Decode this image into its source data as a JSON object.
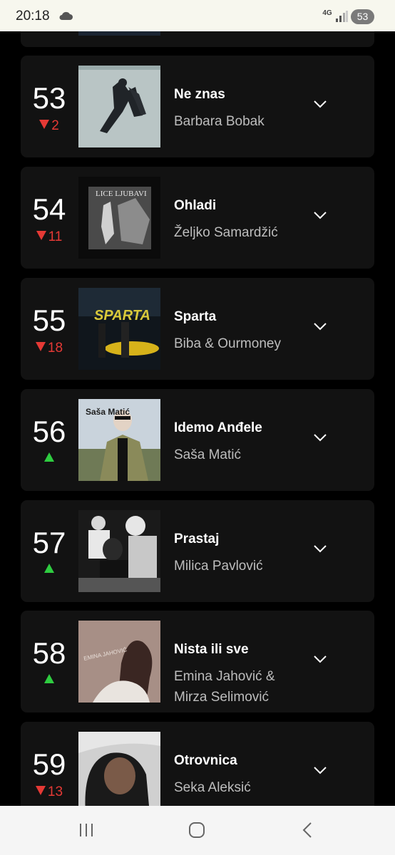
{
  "status_bar": {
    "time": "20:18",
    "network": "4G",
    "battery": "53"
  },
  "chart": [
    {
      "rank": "53",
      "change": "2",
      "direction": "down",
      "title": "Ne znas",
      "artist": "Barbara Bobak"
    },
    {
      "rank": "54",
      "change": "11",
      "direction": "down",
      "title": "Ohladi",
      "artist": "Željko Samardžić"
    },
    {
      "rank": "55",
      "change": "18",
      "direction": "down",
      "title": "Sparta",
      "artist": "Biba & Ourmoney"
    },
    {
      "rank": "56",
      "change": "",
      "direction": "up",
      "title": "Idemo Anđele",
      "artist": "Saša Matić"
    },
    {
      "rank": "57",
      "change": "",
      "direction": "up",
      "title": "Prastaj",
      "artist": "Milica Pavlović"
    },
    {
      "rank": "58",
      "change": "",
      "direction": "up",
      "title": "Nista ili sve",
      "artist": "Emina Jahović & Mirza Selimović"
    },
    {
      "rank": "59",
      "change": "13",
      "direction": "down",
      "title": "Otrovnica",
      "artist": "Seka Aleksić"
    }
  ],
  "cover_art_text": {
    "ohladi": "LICE LJUBAVI",
    "sparta": "SPARTA",
    "idemo": "Saša Matić",
    "nista": "EMINA JAHOVIĆ"
  },
  "colors": {
    "down": "#e53935",
    "up": "#2ecc40",
    "card": "#121212",
    "background": "#000000"
  }
}
